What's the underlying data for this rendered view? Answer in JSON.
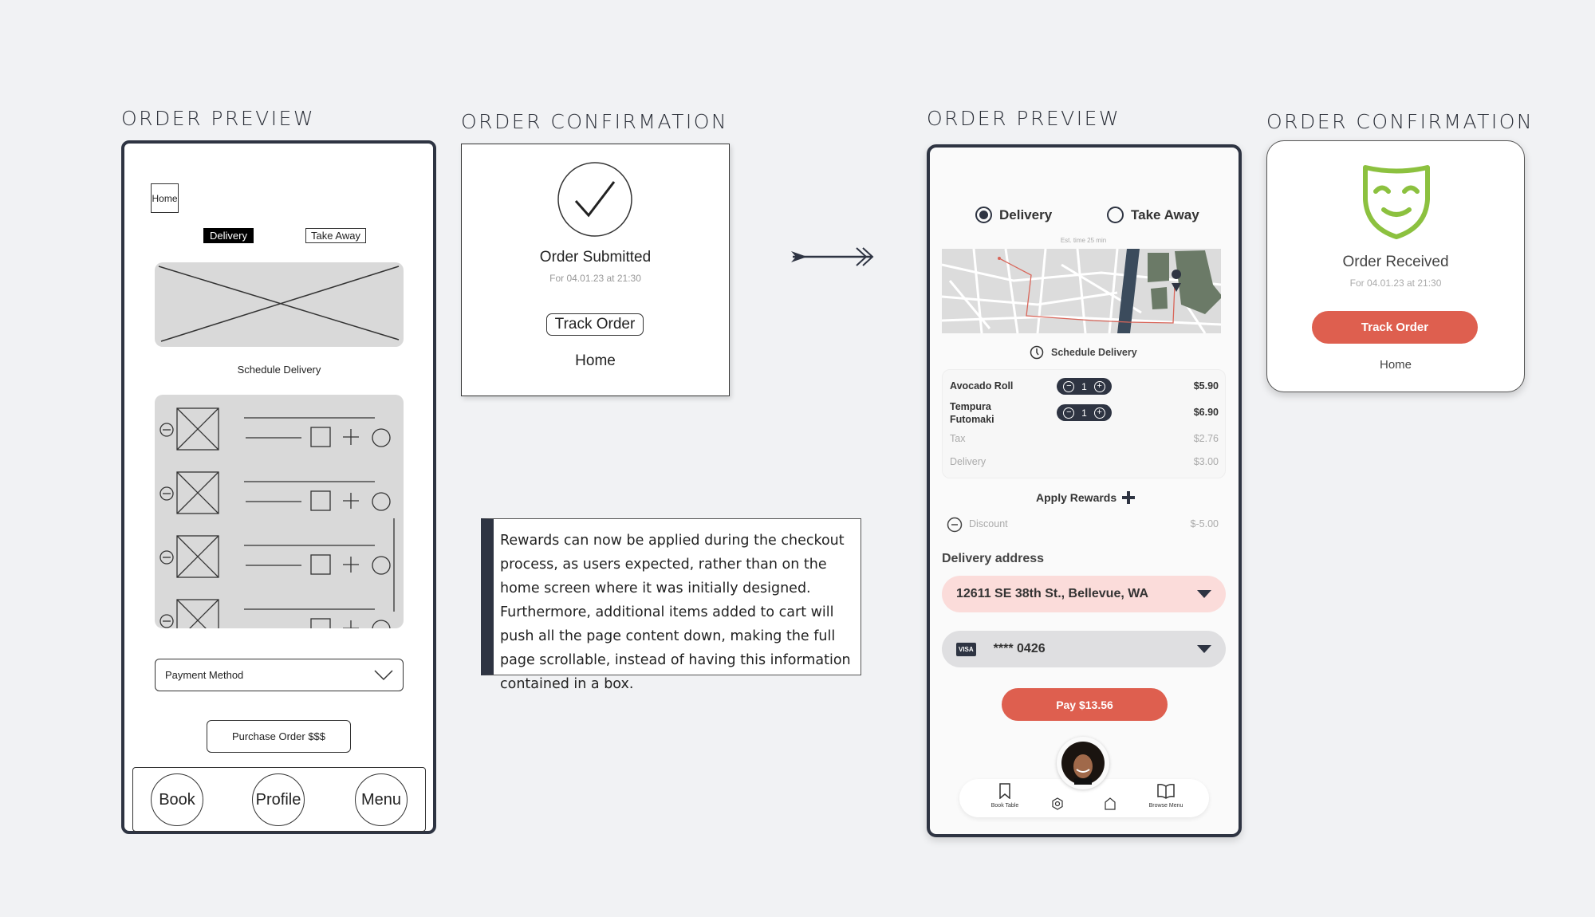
{
  "titles": {
    "left_preview": "ORDER PREVIEW",
    "left_confirm": "ORDER CONFIRMATION",
    "right_preview": "ORDER PREVIEW",
    "right_confirm": "ORDER CONFIRMATION"
  },
  "wireframe_preview": {
    "home": "Home",
    "delivery": "Delivery",
    "take_away": "Take Away",
    "schedule": "Schedule Delivery",
    "payment_method": "Payment Method",
    "purchase": "Purchase Order $$$",
    "nav": [
      "Book",
      "Profile",
      "Menu"
    ],
    "item_count": 4
  },
  "wireframe_confirm": {
    "title": "Order Submitted",
    "date": "For 04.01.23 at 21:30",
    "track": "Track Order",
    "home": "Home"
  },
  "note": "Rewards can now be applied during the checkout process, as users expected, rather than on the home screen where it was initially designed. Furthermore, additional items added to cart will push all the page content down, making the full page scrollable, instead of having this information contained in a box.",
  "preview": {
    "options": [
      {
        "label": "Delivery",
        "selected": true
      },
      {
        "label": "Take Away",
        "selected": false
      }
    ],
    "est_time": "Est. time 25 min",
    "schedule": "Schedule Delivery",
    "items": [
      {
        "name": "Avocado Roll",
        "qty": "1",
        "price": "$5.90"
      },
      {
        "name": "Tempura Futomaki",
        "qty": "1",
        "price": "$6.90"
      }
    ],
    "tax": {
      "label": "Tax",
      "value": "$2.76"
    },
    "delivery": {
      "label": "Delivery",
      "value": "$3.00"
    },
    "apply_rewards": "Apply Rewards",
    "discount": {
      "label": "Discount",
      "value": "$-5.00"
    },
    "address_label": "Delivery address",
    "address": "12611 SE 38th St., Bellevue, WA",
    "card_brand": "VISA",
    "card": "**** 0426",
    "pay": "Pay $13.56",
    "nav": {
      "book": "Book Table",
      "browse": "Browse Menu"
    }
  },
  "confirm": {
    "title": "Order Received",
    "date": "For 04.01.23 at 21:30",
    "track": "Track Order",
    "home": "Home"
  },
  "colors": {
    "accent": "#de5f4f",
    "address_bg": "#fbdcda",
    "mask": "#8cc13f",
    "dark": "#2e3442"
  }
}
